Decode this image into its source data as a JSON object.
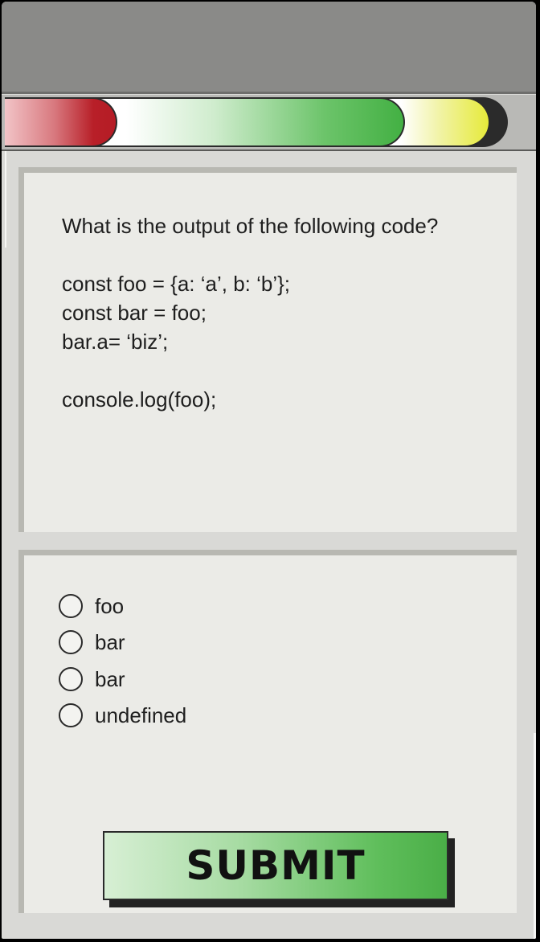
{
  "quiz": {
    "progress_colors": {
      "wrong": "#b51c25",
      "correct": "#43b043",
      "partial": "#e6ea3a",
      "remaining": "#2b2b2b"
    },
    "question": "What is the output of the following code?",
    "code_lines": [
      "const foo = {a: ‘a’, b: ‘b’};",
      "const bar = foo;",
      "bar.a= ‘biz’;",
      "",
      "console.log(foo);"
    ],
    "options": [
      {
        "label": "foo",
        "selected": false
      },
      {
        "label": "bar",
        "selected": false
      },
      {
        "label": "bar",
        "selected": false
      },
      {
        "label": "undefined",
        "selected": false
      }
    ],
    "submit_label": "SUBMIT"
  }
}
